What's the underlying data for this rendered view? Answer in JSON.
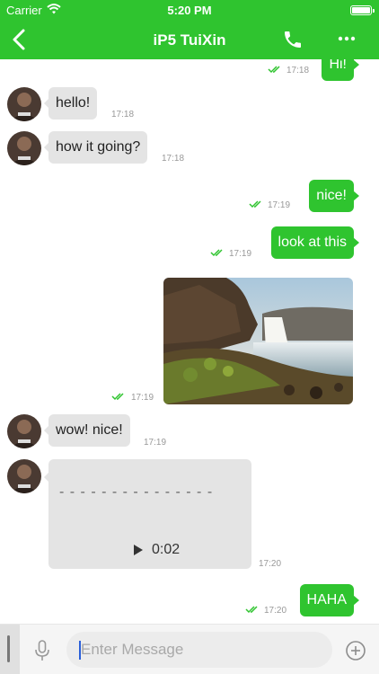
{
  "status_bar": {
    "carrier": "Carrier",
    "time": "5:20 PM"
  },
  "nav": {
    "title": "iP5 TuiXin",
    "back_icon": "chevron-left-icon",
    "call_icon": "phone-icon",
    "more_icon": "more-dots-icon"
  },
  "colors": {
    "accent": "#2fc42f",
    "incoming_bubble": "#e4e4e4",
    "outgoing_text": "#ffffff",
    "time_text": "#999999"
  },
  "messages": [
    {
      "direction": "out",
      "type": "text",
      "text": "Hi!",
      "time": "17:18",
      "status": "read"
    },
    {
      "direction": "in",
      "type": "text",
      "text": "hello!",
      "time": "17:18"
    },
    {
      "direction": "in",
      "type": "text",
      "text": "how it going?",
      "time": "17:18"
    },
    {
      "direction": "out",
      "type": "text",
      "text": "nice!",
      "time": "17:19",
      "status": "read"
    },
    {
      "direction": "out",
      "type": "text",
      "text": "look at this",
      "time": "17:19",
      "status": "read"
    },
    {
      "direction": "out",
      "type": "image",
      "time": "17:19",
      "status": "read"
    },
    {
      "direction": "in",
      "type": "text",
      "text": "wow! nice!",
      "time": "17:19"
    },
    {
      "direction": "in",
      "type": "voice",
      "waveform": "- - - - - - - - - - - - - - -",
      "duration": "0:02",
      "time": "17:20"
    },
    {
      "direction": "out",
      "type": "text",
      "text": "HAHA",
      "time": "17:20",
      "status": "read"
    }
  ],
  "input": {
    "placeholder": "Enter Message",
    "value": "",
    "mic_icon": "microphone-icon",
    "plus_icon": "add-circle-icon"
  }
}
